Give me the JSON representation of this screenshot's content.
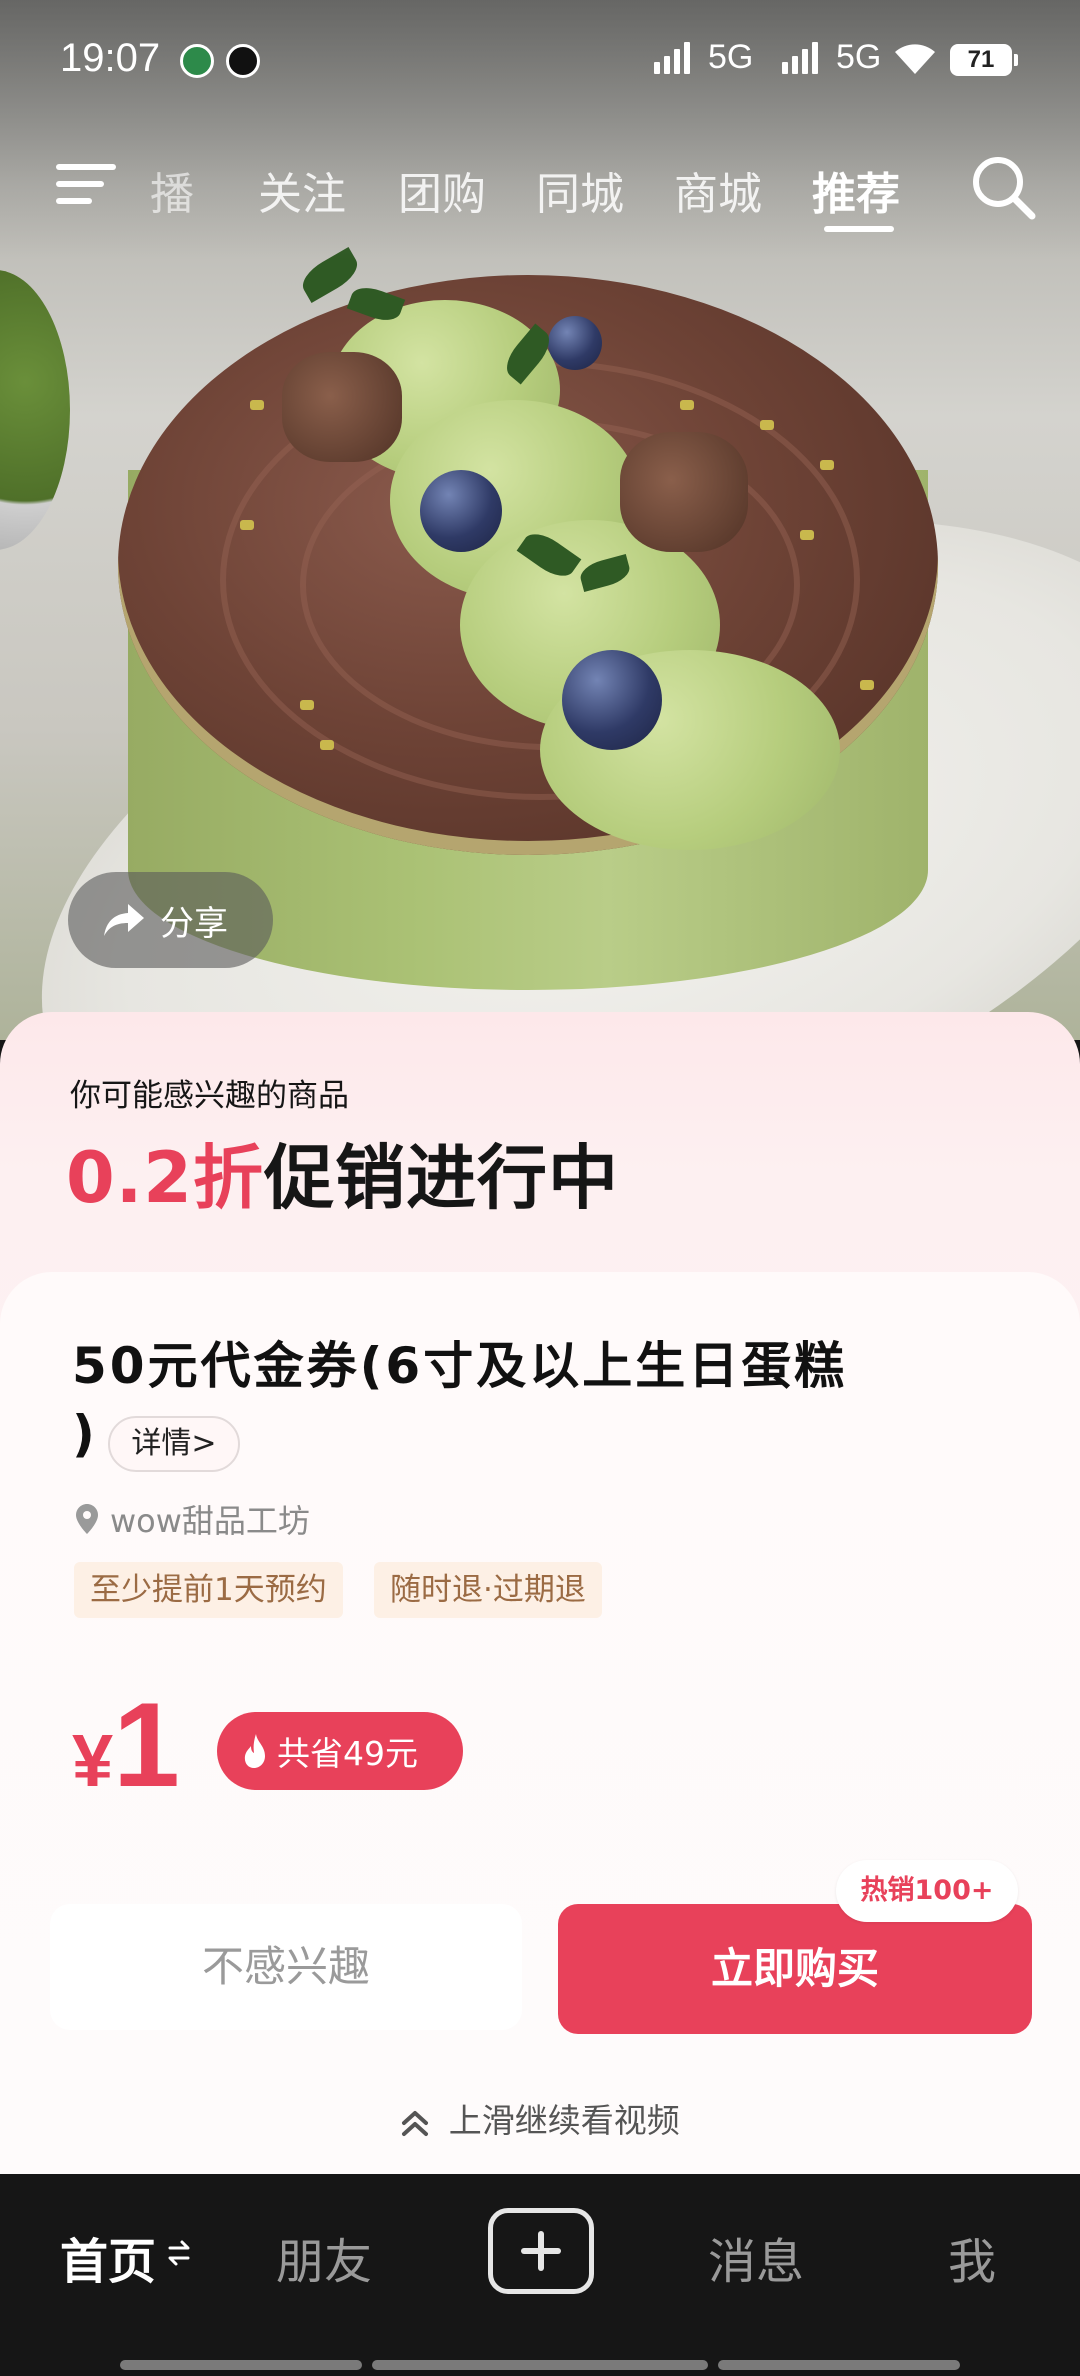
{
  "status_bar": {
    "time": "19:07",
    "network_1": "5G",
    "network_2": "5G",
    "battery": "71",
    "icons": [
      "app-notification-icon",
      "qq-icon",
      "signal-icon",
      "wifi-icon",
      "battery-icon"
    ]
  },
  "top_nav": {
    "tabs": [
      {
        "label": "播"
      },
      {
        "label": "关注"
      },
      {
        "label": "团购"
      },
      {
        "label": "同城"
      },
      {
        "label": "商城"
      },
      {
        "label": "推荐",
        "active": true
      }
    ],
    "menu_icon": "menu-icon",
    "search_icon": "search-icon"
  },
  "share": {
    "label": "分享",
    "icon": "share-icon"
  },
  "promo": {
    "kicker": "你可能感兴趣的商品",
    "highlight": "0.2折",
    "rest": "促销进行中"
  },
  "product": {
    "title_line1": "50元代金券(6寸及以上生日蛋糕",
    "title_line2": ")",
    "detail_label": "详情>",
    "shop": "wow甜品工坊",
    "tags": [
      "至少提前1天预约",
      "随时退·过期退"
    ],
    "price_currency": "¥",
    "price_value": "1",
    "save_label": "共省49元"
  },
  "actions": {
    "not_interested": "不感兴趣",
    "buy_now": "立即购买",
    "hot_badge": "热销100+"
  },
  "swipe_hint": "上滑继续看视频",
  "bottom_nav": {
    "items": [
      {
        "label": "首页",
        "active": true
      },
      {
        "label": "朋友"
      },
      {
        "label": "消息"
      },
      {
        "label": "我"
      }
    ],
    "create_icon": "plus-icon"
  },
  "colors": {
    "accent": "#e8415a",
    "tag_bg": "#fdf0e5",
    "tag_text": "#9b6b44",
    "nav_bg": "#161616"
  }
}
